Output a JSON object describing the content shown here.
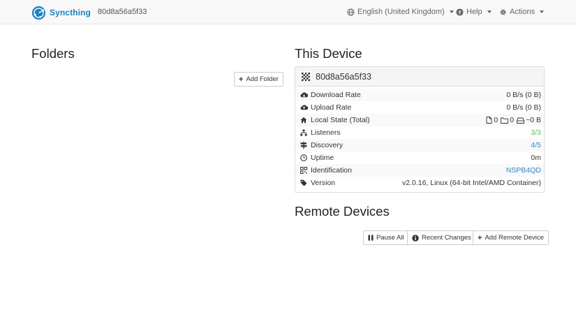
{
  "navbar": {
    "brand": "Syncthing",
    "device_name": "80d8a56a5f33",
    "language": "English (United Kingdom)",
    "help": "Help",
    "actions": "Actions"
  },
  "folders": {
    "heading": "Folders",
    "add_button": "Add Folder"
  },
  "this_device": {
    "heading": "This Device",
    "name": "80d8a56a5f33",
    "rows": [
      {
        "label": "Download Rate",
        "value": "0 B/s (0 B)",
        "icon": "cloud-download-icon"
      },
      {
        "label": "Upload Rate",
        "value": "0 B/s (0 B)",
        "icon": "cloud-upload-icon"
      },
      {
        "label": "Local State (Total)",
        "icon": "home-icon",
        "files": "0",
        "dirs": "0",
        "size": "~0 B"
      },
      {
        "label": "Listeners",
        "value": "3/3",
        "icon": "sitemap-icon"
      },
      {
        "label": "Discovery",
        "value": "4/5",
        "icon": "signpost-icon"
      },
      {
        "label": "Uptime",
        "value": "0m",
        "icon": "clock-icon"
      },
      {
        "label": "Identification",
        "value": "NSPB4QD",
        "icon": "qrcode-icon"
      },
      {
        "label": "Version",
        "value": "v2.0.16, Linux (64-bit Intel/AMD Container)",
        "icon": "tag-icon"
      }
    ]
  },
  "remote_devices": {
    "heading": "Remote Devices",
    "pause_all": "Pause All",
    "recent_changes": "Recent Changes",
    "add_remote": "Add Remote Device"
  },
  "colors": {
    "brand": "#1a82c5",
    "ok_green": "#5cb85c",
    "link_blue": "#2a8bc8"
  }
}
